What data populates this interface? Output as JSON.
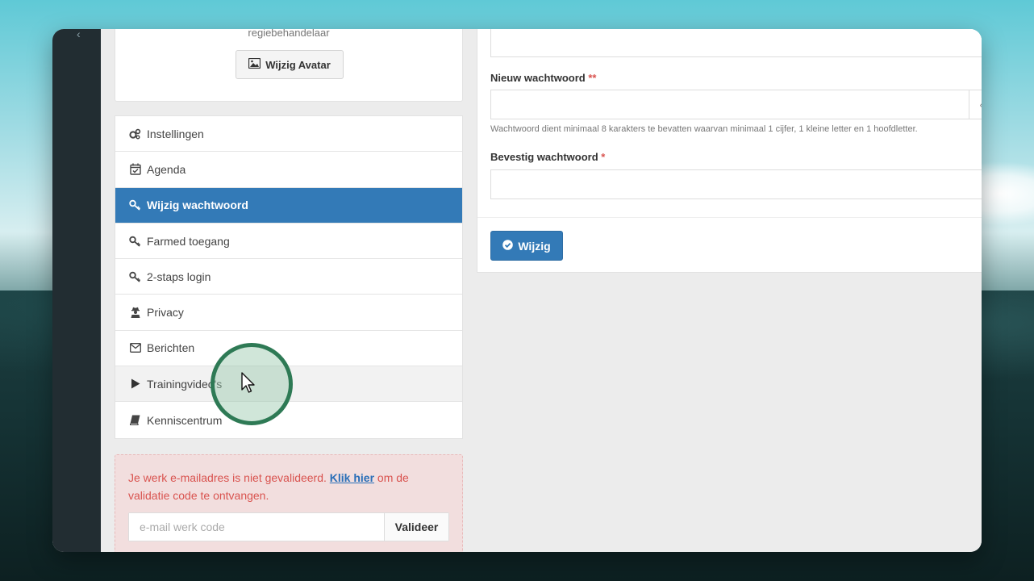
{
  "profile": {
    "role": "regiebehandelaar",
    "avatar_button": "Wijzig Avatar"
  },
  "menu": {
    "items": [
      {
        "label": "Instellingen",
        "icon": "gears-icon"
      },
      {
        "label": "Agenda",
        "icon": "calendar-check-icon"
      },
      {
        "label": "Wijzig wachtwoord",
        "icon": "key-icon",
        "active": true
      },
      {
        "label": "Farmed toegang",
        "icon": "key-icon"
      },
      {
        "label": "2-staps login",
        "icon": "key-icon"
      },
      {
        "label": "Privacy",
        "icon": "user-secret-icon"
      },
      {
        "label": "Berichten",
        "icon": "envelope-icon"
      },
      {
        "label": "Trainingvideo's",
        "icon": "play-icon",
        "hover": true
      },
      {
        "label": "Kenniscentrum",
        "icon": "book-icon"
      }
    ]
  },
  "alert": {
    "text_before": "Je werk e-mailadres is niet gevalideerd.",
    "link": "Klik hier",
    "text_after": "om de validatie code te ontvangen.",
    "input_placeholder": "e-mail werk code",
    "button": "Valideer"
  },
  "form": {
    "new_password_label": "Nieuw wachtwoord",
    "new_password_required": "**",
    "help_text": "Wachtwoord dient minimaal 8 karakters te bevatten waarvan minimaal 1 cijfer, 1 kleine letter en 1 hoofdletter.",
    "confirm_label": "Bevestig wachtwoord",
    "confirm_required": "*",
    "submit": "Wijzig"
  },
  "colors": {
    "primary": "#337ab7",
    "danger": "#d9534f",
    "sidebar": "#222d32",
    "click_ring": "#2e7a55"
  }
}
